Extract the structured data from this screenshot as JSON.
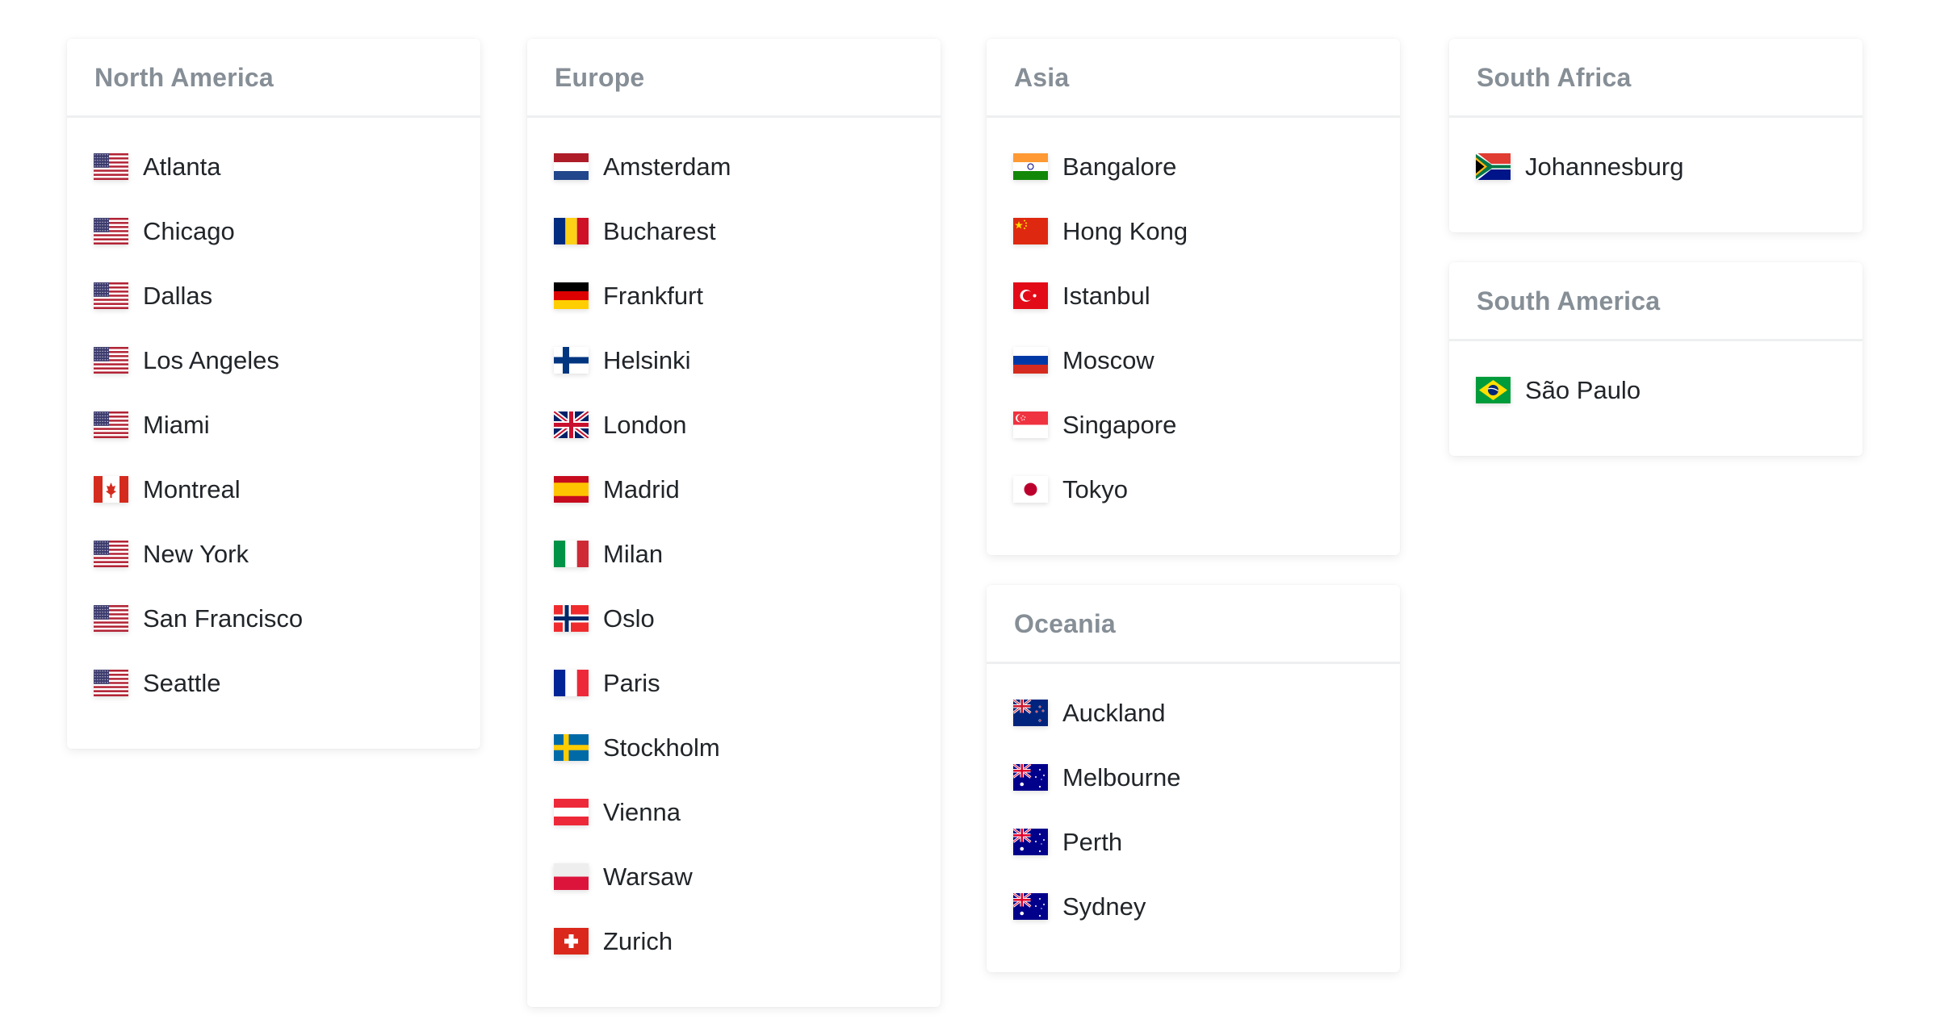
{
  "regions": [
    {
      "id": "north-america",
      "title": "North America",
      "cities": [
        {
          "name": "Atlanta",
          "flag": "us"
        },
        {
          "name": "Chicago",
          "flag": "us"
        },
        {
          "name": "Dallas",
          "flag": "us"
        },
        {
          "name": "Los Angeles",
          "flag": "us"
        },
        {
          "name": "Miami",
          "flag": "us"
        },
        {
          "name": "Montreal",
          "flag": "ca"
        },
        {
          "name": "New York",
          "flag": "us"
        },
        {
          "name": "San Francisco",
          "flag": "us"
        },
        {
          "name": "Seattle",
          "flag": "us"
        }
      ]
    },
    {
      "id": "europe",
      "title": "Europe",
      "cities": [
        {
          "name": "Amsterdam",
          "flag": "nl"
        },
        {
          "name": "Bucharest",
          "flag": "ro"
        },
        {
          "name": "Frankfurt",
          "flag": "de"
        },
        {
          "name": "Helsinki",
          "flag": "fi"
        },
        {
          "name": "London",
          "flag": "gb"
        },
        {
          "name": "Madrid",
          "flag": "es"
        },
        {
          "name": "Milan",
          "flag": "it"
        },
        {
          "name": "Oslo",
          "flag": "no"
        },
        {
          "name": "Paris",
          "flag": "fr"
        },
        {
          "name": "Stockholm",
          "flag": "se"
        },
        {
          "name": "Vienna",
          "flag": "at"
        },
        {
          "name": "Warsaw",
          "flag": "pl"
        },
        {
          "name": "Zurich",
          "flag": "ch"
        }
      ]
    },
    {
      "id": "asia",
      "title": "Asia",
      "cities": [
        {
          "name": "Bangalore",
          "flag": "in"
        },
        {
          "name": "Hong Kong",
          "flag": "cn"
        },
        {
          "name": "Istanbul",
          "flag": "tr"
        },
        {
          "name": "Moscow",
          "flag": "ru"
        },
        {
          "name": "Singapore",
          "flag": "sg"
        },
        {
          "name": "Tokyo",
          "flag": "jp"
        }
      ]
    },
    {
      "id": "oceania",
      "title": "Oceania",
      "cities": [
        {
          "name": "Auckland",
          "flag": "nz"
        },
        {
          "name": "Melbourne",
          "flag": "au"
        },
        {
          "name": "Perth",
          "flag": "au"
        },
        {
          "name": "Sydney",
          "flag": "au"
        }
      ]
    },
    {
      "id": "south-africa",
      "title": "South Africa",
      "cities": [
        {
          "name": "Johannesburg",
          "flag": "za"
        }
      ]
    },
    {
      "id": "south-america",
      "title": "South America",
      "cities": [
        {
          "name": "São Paulo",
          "flag": "br"
        }
      ]
    }
  ],
  "colors": {
    "title": "#868e96",
    "text": "#212529",
    "divider": "#eeeff0"
  }
}
